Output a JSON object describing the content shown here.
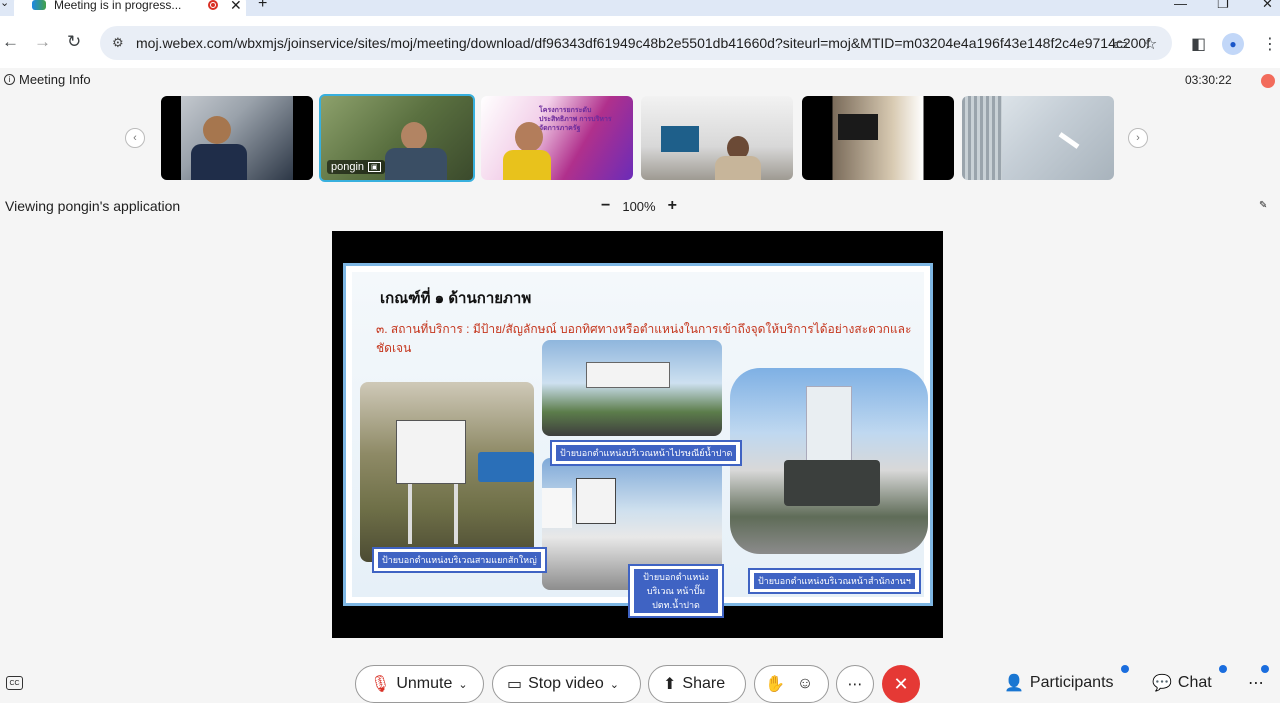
{
  "browser": {
    "tab_title": "Meeting is in progress...",
    "url": "moj.webex.com/wbxmjs/joinservice/sites/moj/meeting/download/df96343df61949c48b2e5501db41660d?siteurl=moj&MTID=m03204e4a196f43e148f2c4e9714c200f"
  },
  "meeting": {
    "info_label": "Meeting Info",
    "timer": "03:30:22",
    "viewing_text": "Viewing pongin's application",
    "zoom_level": "100%",
    "thumbnails": [
      {
        "label": ""
      },
      {
        "label": "pongin"
      },
      {
        "label": ""
      },
      {
        "label": ""
      },
      {
        "label": ""
      },
      {
        "label": ""
      }
    ]
  },
  "slide": {
    "title": "เกณฑ์ที่ ๑ ด้านกายภาพ",
    "subtitle": "๓. สถานที่บริการ : มีป้าย/สัญลักษณ์ บอกทิศทางหรือตำแหน่งในการเข้าถึงจุดให้บริการได้อย่างสะดวกและชัดเจน",
    "captions": [
      "ป้ายบอกตำแหน่งบริเวณสามแยกสักใหญ่",
      "ป้ายบอกตำแหน่งบริเวณหน้าไปรษณีย์น้ำปาด",
      "ป้ายบอกตำแหน่งบริเวณ หน้าปั๊ม ปตท.น้ำปาด",
      "ป้ายบอกตำแหน่งบริเวณหน้าสำนักงานฯ"
    ]
  },
  "controls": {
    "unmute": "Unmute",
    "stop_video": "Stop video",
    "share": "Share",
    "participants": "Participants",
    "chat": "Chat"
  }
}
